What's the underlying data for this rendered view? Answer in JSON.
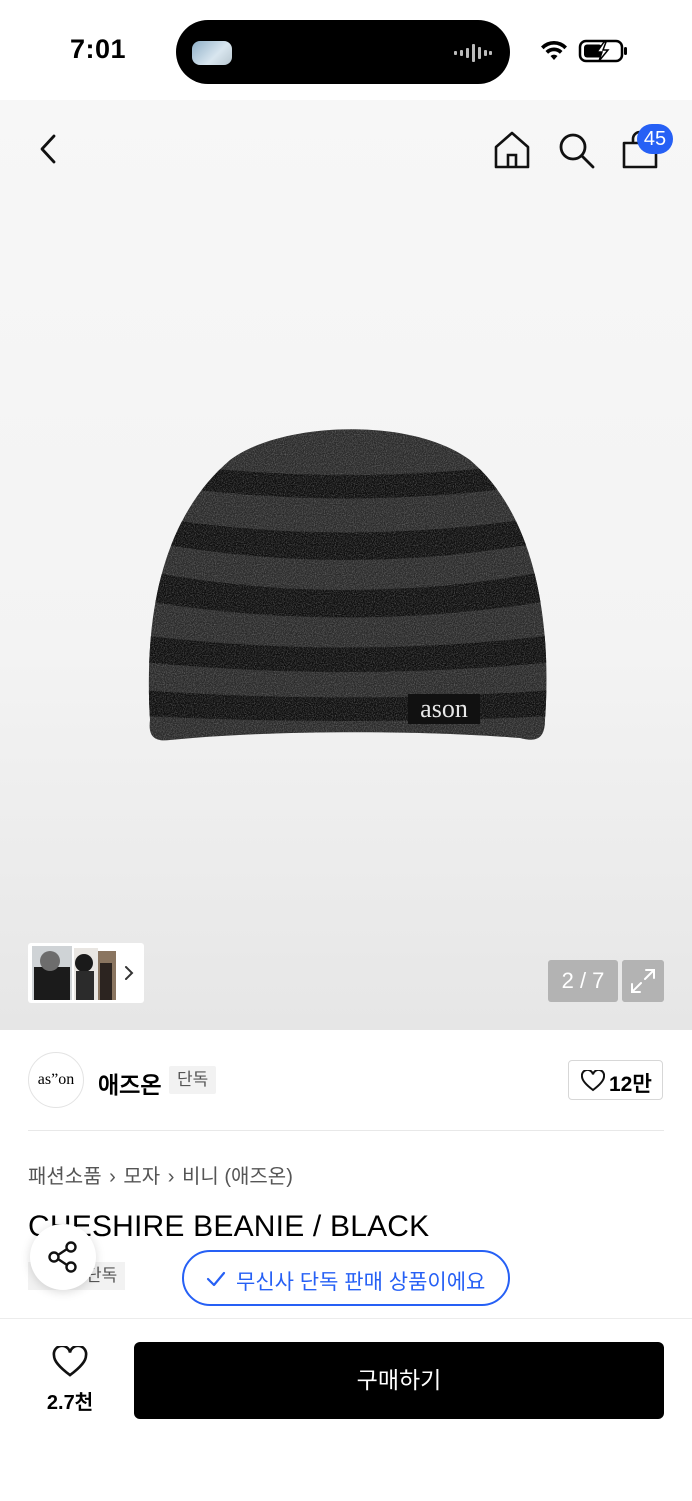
{
  "status_bar": {
    "time": "7:01",
    "battery_state": "charging"
  },
  "nav": {
    "back_icon": "chevron-left-icon",
    "home_icon": "home-icon",
    "search_icon": "search-icon",
    "bag_icon": "shopping-bag-icon",
    "cart_count": "45"
  },
  "gallery": {
    "counter": "2 / 7",
    "product_label": "ason"
  },
  "brand": {
    "logo_text": "as”on",
    "name": "애즈온",
    "tag": "단독",
    "likes": "12만"
  },
  "breadcrumb": [
    "패션소품",
    "모자",
    "비니 (애즈온)"
  ],
  "product": {
    "title": "CHESHIRE BEANIE / BLACK",
    "tag": "단독",
    "exclusive_notice": "무신사 단독 판매 상품이에요"
  },
  "bottom_bar": {
    "wish_count": "2.7천",
    "buy_label": "구매하기"
  },
  "colors": {
    "accent": "#2660f5",
    "buy_button": "#000000"
  }
}
